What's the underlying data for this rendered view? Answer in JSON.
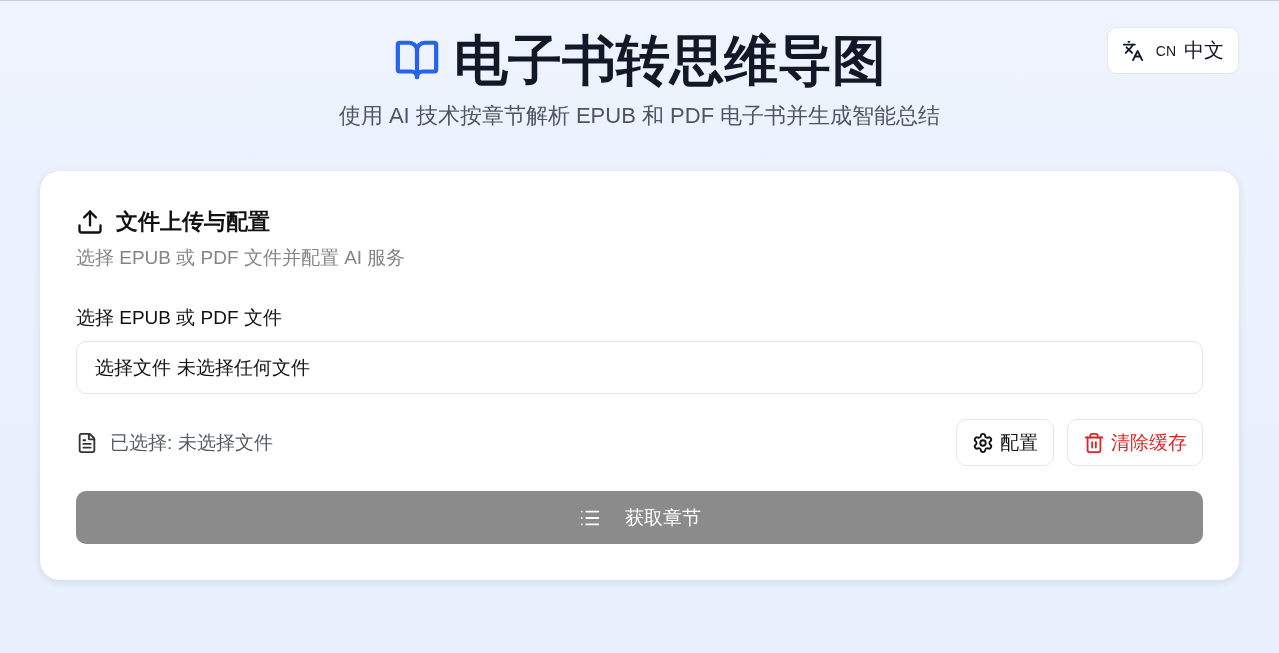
{
  "header": {
    "title": "电子书转思维导图",
    "subtitle": "使用 AI 技术按章节解析 EPUB 和 PDF 电子书并生成智能总结"
  },
  "language_button": {
    "code": "CN",
    "label": "中文"
  },
  "upload_card": {
    "title": "文件上传与配置",
    "description": "选择 EPUB 或 PDF 文件并配置 AI 服务",
    "file_field": {
      "label": "选择 EPUB 或 PDF 文件",
      "button": "选择文件",
      "value": "未选择任何文件"
    },
    "selection": {
      "label": "已选择: 未选择文件"
    },
    "actions": [
      {
        "kind": "config",
        "label": "配置"
      },
      {
        "kind": "clear",
        "label": "清除缓存"
      }
    ],
    "submit": {
      "label": "获取章节",
      "disabled": true
    }
  }
}
